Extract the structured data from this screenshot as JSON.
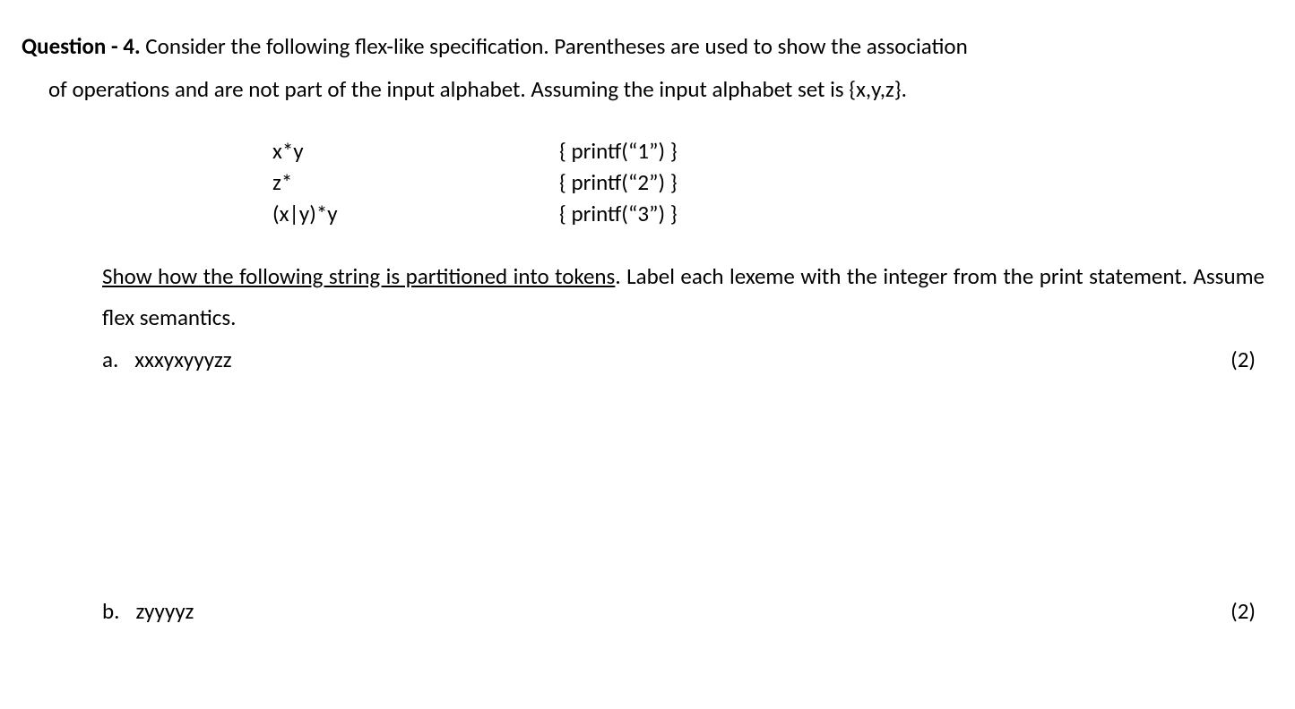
{
  "header": {
    "label": "Question - 4.",
    "line1_rest": " Consider the following flex-like specification. Parentheses are used to show the association",
    "line2": "of operations and are not part of the input alphabet. Assuming the input alphabet set is {x,y,z}."
  },
  "spec": [
    {
      "pattern": "x*y",
      "action": "{ printf(“1”) }"
    },
    {
      "pattern": "z*",
      "action": "{ printf(“2”) }"
    },
    {
      "pattern": "(x|y)*y",
      "action": "{ printf(“3”) }"
    }
  ],
  "task": {
    "underlined": "Show how the following string is partitioned into tokens",
    "rest": ". Label each lexeme with the integer from the print statement. Assume flex semantics."
  },
  "subparts": {
    "a": {
      "letter": "a.",
      "string": "xxxyxyyyzz",
      "marks": "(2)"
    },
    "b": {
      "letter": "b.",
      "string": "zyyyyz",
      "marks": "(2)"
    }
  }
}
